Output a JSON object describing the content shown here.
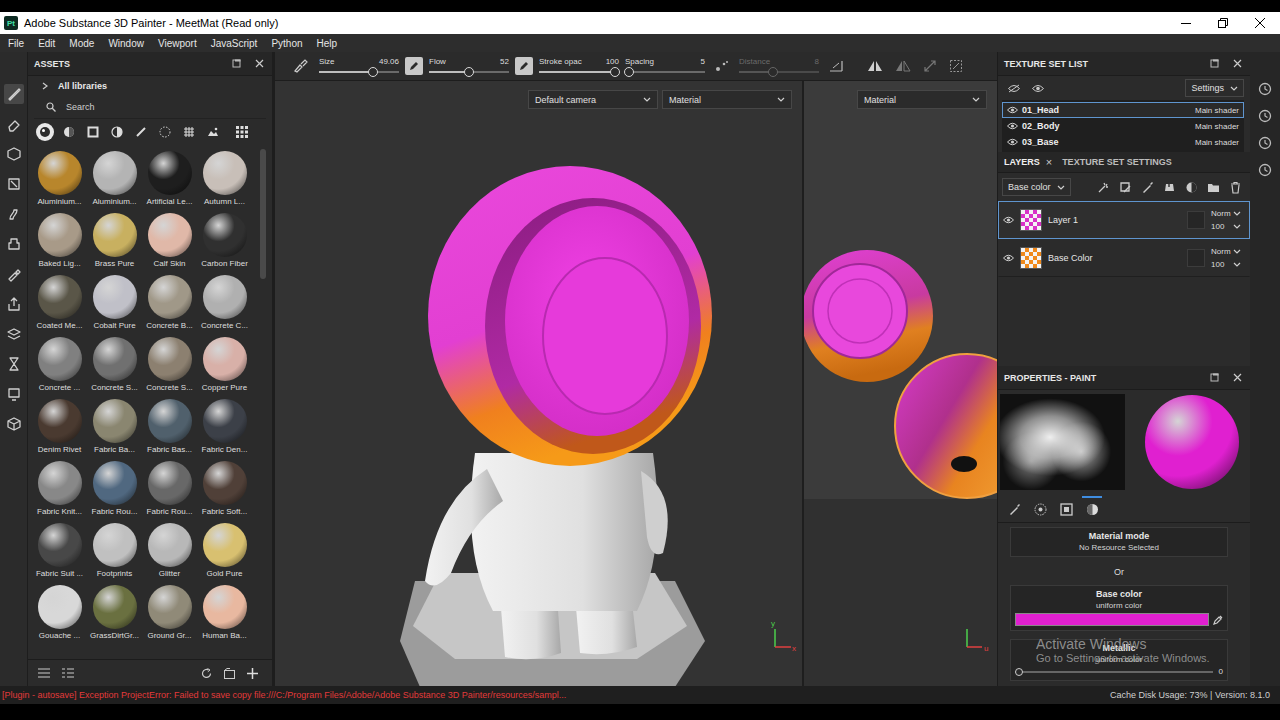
{
  "window": {
    "title": "Adobe Substance 3D Painter - MeetMat (Read only)",
    "app_icon": "Pt"
  },
  "menu": [
    "File",
    "Edit",
    "Mode",
    "Window",
    "Viewport",
    "JavaScript",
    "Python",
    "Help"
  ],
  "toolbar": {
    "sliders": [
      {
        "label": "Size",
        "value": "49.06",
        "level": 0.67,
        "disabled": false
      },
      {
        "label": "Flow",
        "value": "52",
        "level": 0.5,
        "disabled": false
      },
      {
        "label": "Stroke opac",
        "value": "100",
        "level": 0.95,
        "disabled": false
      },
      {
        "label": "Spacing",
        "value": "5",
        "level": 0.05,
        "disabled": false
      },
      {
        "label": "Distance",
        "value": "8",
        "level": 0.42,
        "disabled": true
      }
    ]
  },
  "viewport": {
    "camera": "Default camera",
    "mode_3d": "Material",
    "mode_2d": "Material",
    "axes_3d": [
      "y",
      "x"
    ],
    "axes_2d": [
      "u"
    ]
  },
  "assets": {
    "title": "ASSETS",
    "library": "All libraries",
    "search_placeholder": "Search",
    "items": [
      {
        "name": "Aluminium...",
        "color": "#b8862c"
      },
      {
        "name": "Aluminium...",
        "color": "#b4b4b4"
      },
      {
        "name": "Artificial Le...",
        "color": "#1e1e1e"
      },
      {
        "name": "Autumn L...",
        "color": "#c8bfb8"
      },
      {
        "name": "Baked Lig...",
        "color": "#a89a88"
      },
      {
        "name": "Brass Pure",
        "color": "#c8b060"
      },
      {
        "name": "Calf Skin",
        "color": "#e0b8a8"
      },
      {
        "name": "Carbon Fiber",
        "color": "#303030"
      },
      {
        "name": "Coated Me...",
        "color": "#5a5648"
      },
      {
        "name": "Cobalt Pure",
        "color": "#c0c0c8"
      },
      {
        "name": "Concrete B...",
        "color": "#a09888"
      },
      {
        "name": "Concrete C...",
        "color": "#b0b0b0"
      },
      {
        "name": "Concrete ...",
        "color": "#808080"
      },
      {
        "name": "Concrete S...",
        "color": "#707070"
      },
      {
        "name": "Concrete S...",
        "color": "#8c8070"
      },
      {
        "name": "Copper Pure",
        "color": "#d8b0a8"
      },
      {
        "name": "Denim Rivet",
        "color": "#4a3a30"
      },
      {
        "name": "Fabric Ba...",
        "color": "#8a8670"
      },
      {
        "name": "Fabric Bas...",
        "color": "#50606c"
      },
      {
        "name": "Fabric Den...",
        "color": "#3c4048"
      },
      {
        "name": "Fabric Knit...",
        "color": "#888888"
      },
      {
        "name": "Fabric Rou...",
        "color": "#506880"
      },
      {
        "name": "Fabric Rou...",
        "color": "#686868"
      },
      {
        "name": "Fabric Soft...",
        "color": "#504038"
      },
      {
        "name": "Fabric Suit ...",
        "color": "#484848"
      },
      {
        "name": "Footprints",
        "color": "#c0c0c0"
      },
      {
        "name": "Glitter",
        "color": "#b8b8b8"
      },
      {
        "name": "Gold Pure",
        "color": "#d8c070"
      },
      {
        "name": "Gouache ...",
        "color": "#d8d8d8"
      },
      {
        "name": "GrassDirtGr...",
        "color": "#6a7040"
      },
      {
        "name": "Ground Gr...",
        "color": "#908a78"
      },
      {
        "name": "Human Ba...",
        "color": "#e8b8a0"
      }
    ]
  },
  "texture_sets": {
    "title": "TEXTURE SET LIST",
    "settings": "Settings",
    "items": [
      {
        "name": "01_Head",
        "shader": "Main shader",
        "selected": true,
        "visible": true
      },
      {
        "name": "02_Body",
        "shader": "Main shader",
        "selected": false,
        "visible": true
      },
      {
        "name": "03_Base",
        "shader": "Main shader",
        "selected": false,
        "visible": true
      }
    ]
  },
  "layers": {
    "tabs": [
      {
        "label": "LAYERS",
        "selected": true,
        "close": "×"
      },
      {
        "label": "TEXTURE SET SETTINGS",
        "selected": false,
        "close": ""
      }
    ],
    "channel": "Base color",
    "items": [
      {
        "name": "Layer 1",
        "blend": "Norm",
        "opacity": "100",
        "selected": true,
        "visible": true,
        "color": "#d832c8"
      },
      {
        "name": "Base Color",
        "blend": "Norm",
        "opacity": "100",
        "selected": false,
        "visible": true,
        "color": "#f08a1c"
      }
    ]
  },
  "properties": {
    "title": "PROPERTIES - PAINT",
    "tabs": [
      {
        "selected": false
      },
      {
        "selected": false
      },
      {
        "selected": false
      },
      {
        "selected": true
      }
    ],
    "material_mode": {
      "label": "Material mode",
      "value": "No Resource Selected"
    },
    "or": "Or",
    "base_color": {
      "label": "Base color",
      "value": "uniform color",
      "color": "#e020d0"
    },
    "metallic": {
      "label": "Metallic",
      "value": "uniform color",
      "reading": "0",
      "level": 0.0
    }
  },
  "watermark": {
    "title": "Activate Windows",
    "text": "Go to Settings to activate Windows."
  },
  "status_bar": {
    "error": "[Plugin - autosave] Exception ProjectError: Failed to save copy file:///C:/Program Files/Adobe/Adobe Substance 3D Painter/resources/sampl...",
    "info": "Cache Disk Usage: 73% | Version: 8.1.0"
  }
}
